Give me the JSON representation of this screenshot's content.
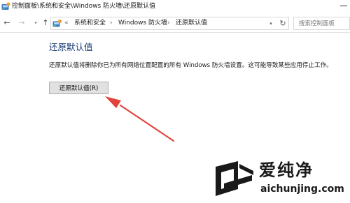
{
  "window": {
    "title": "控制面板\\系统和安全\\Windows 防火墙\\还原默认值"
  },
  "nav": {
    "back": "←",
    "forward": "→",
    "recent": "▾",
    "up": "↑"
  },
  "address": {
    "chevron": "«",
    "crumbs": [
      "系统和安全",
      "Windows 防火墙",
      "还原默认值"
    ],
    "separator": "›",
    "dropdown": "▾",
    "refresh": "↻"
  },
  "search": {
    "placeholder": "搜索控制面板"
  },
  "content": {
    "heading": "还原默认值",
    "description": "还原默认值将删除你已为所有网络位置配置的所有 Windows 防火墙设置。这可能导致某些应用停止工作。",
    "restore_button": "还原默认值(R)"
  },
  "watermark": {
    "brand": "爱纯净",
    "site": "aichunjing.com"
  },
  "colors": {
    "heading": "#1b3d78",
    "annotation_arrow": "#e0443e",
    "button_bg": "#e1e1e1"
  },
  "icons": {
    "app": "control-panel-icon",
    "address": "control-panel-icon",
    "refresh": "refresh-icon",
    "watermark": "aichunjing-logo"
  }
}
